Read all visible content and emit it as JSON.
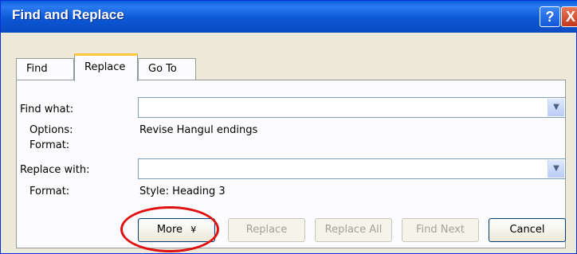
{
  "window": {
    "title": "Find and Replace",
    "help_glyph": "?",
    "close_glyph": "X"
  },
  "tabs": [
    {
      "label": "Find",
      "active": false
    },
    {
      "label": "Replace",
      "active": true
    },
    {
      "label": "Go To",
      "active": false
    }
  ],
  "find": {
    "label": "Find what:",
    "value": "",
    "options_label": "Options:",
    "options_value": "Revise Hangul endings",
    "format_label": "Format:",
    "format_value": ""
  },
  "replace": {
    "label": "Replace with:",
    "value": "",
    "format_label": "Format:",
    "format_value": "Style: Heading 3"
  },
  "buttons": {
    "more": "More",
    "more_glyph": "¥",
    "replace": "Replace",
    "replace_all": "Replace All",
    "find_next": "Find Next",
    "cancel": "Cancel"
  },
  "colors": {
    "titlebar": "#0a5fd9",
    "active_tab_accent": "#ffc83c",
    "highlight_ring": "#e01010"
  },
  "icons": [
    "help-icon",
    "close-icon",
    "dropdown-arrow-icon",
    "expand-icon"
  ]
}
